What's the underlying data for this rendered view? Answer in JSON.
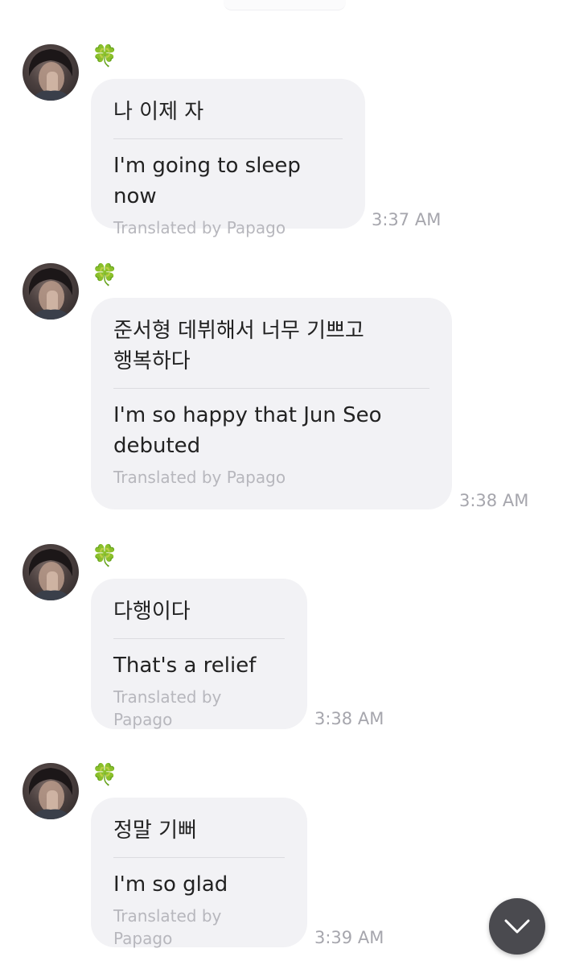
{
  "messages": [
    {
      "sender_emoji": "🍀",
      "original": "나 이제 자",
      "translated": "I'm going to sleep now",
      "credit": "Translated by Papago",
      "time": "3:37 AM"
    },
    {
      "sender_emoji": "🍀",
      "original": "준서형 데뷔해서 너무 기쁘고 행복하다",
      "translated": "I'm so happy that Jun Seo debuted",
      "credit": "Translated by Papago",
      "time": "3:38 AM"
    },
    {
      "sender_emoji": "🍀",
      "original": "다행이다",
      "translated": "That's a relief",
      "credit": "Translated by Papago",
      "time": "3:38 AM"
    },
    {
      "sender_emoji": "🍀",
      "original": "정말 기뻐",
      "translated": "I'm so glad",
      "credit": "Translated by Papago",
      "time": "3:39 AM"
    }
  ],
  "scroll_button": {
    "icon": "chevron-down-icon"
  }
}
